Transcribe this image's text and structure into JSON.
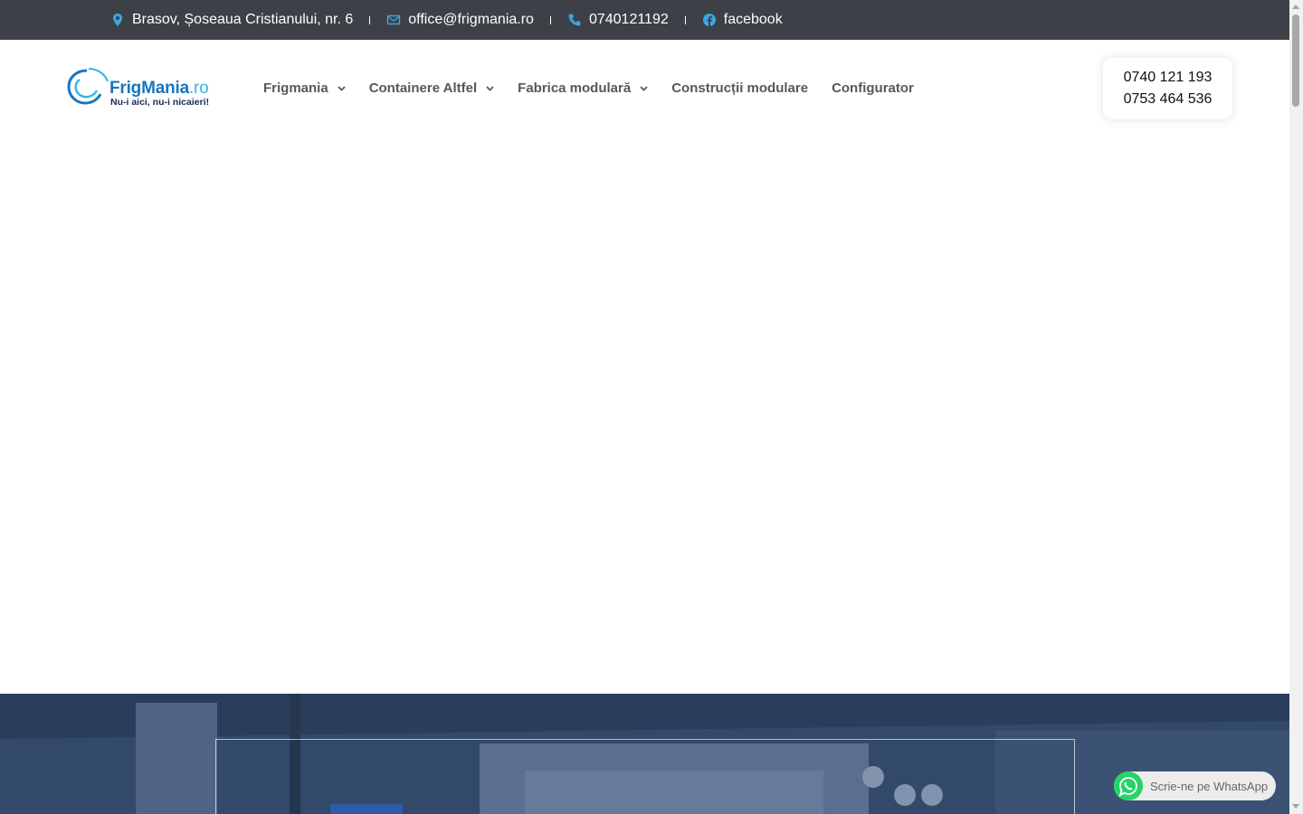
{
  "topbar": {
    "address": "Brasov, Șoseaua Cristianului, nr. 6",
    "email": "office@frigmania.ro",
    "phone": "0740121192",
    "social": "facebook",
    "icons": [
      "map-pin-icon",
      "envelope-icon",
      "phone-icon",
      "facebook-icon"
    ],
    "icon_color": "#3aa6e2"
  },
  "logo": {
    "brand": "FrigMania",
    "tld": ".ro",
    "tagline": "Nu-i aici, nu-i nicaieri!"
  },
  "nav": {
    "items": [
      {
        "label": "Frigmania"
      },
      {
        "label": "Containere Altfel"
      },
      {
        "label": "Fabrica modulară"
      },
      {
        "label": "Construcții modulare"
      },
      {
        "label": "Configurator"
      }
    ]
  },
  "phones": {
    "line1": "0740 121 193",
    "line2": "0753 464 536"
  },
  "whatsapp": {
    "label": "Scrie-ne pe WhatsApp",
    "color": "#25d366"
  },
  "colors": {
    "topbar_bg": "#3d4147",
    "nav_text": "#54595f",
    "hero_bg": "#33496a"
  }
}
